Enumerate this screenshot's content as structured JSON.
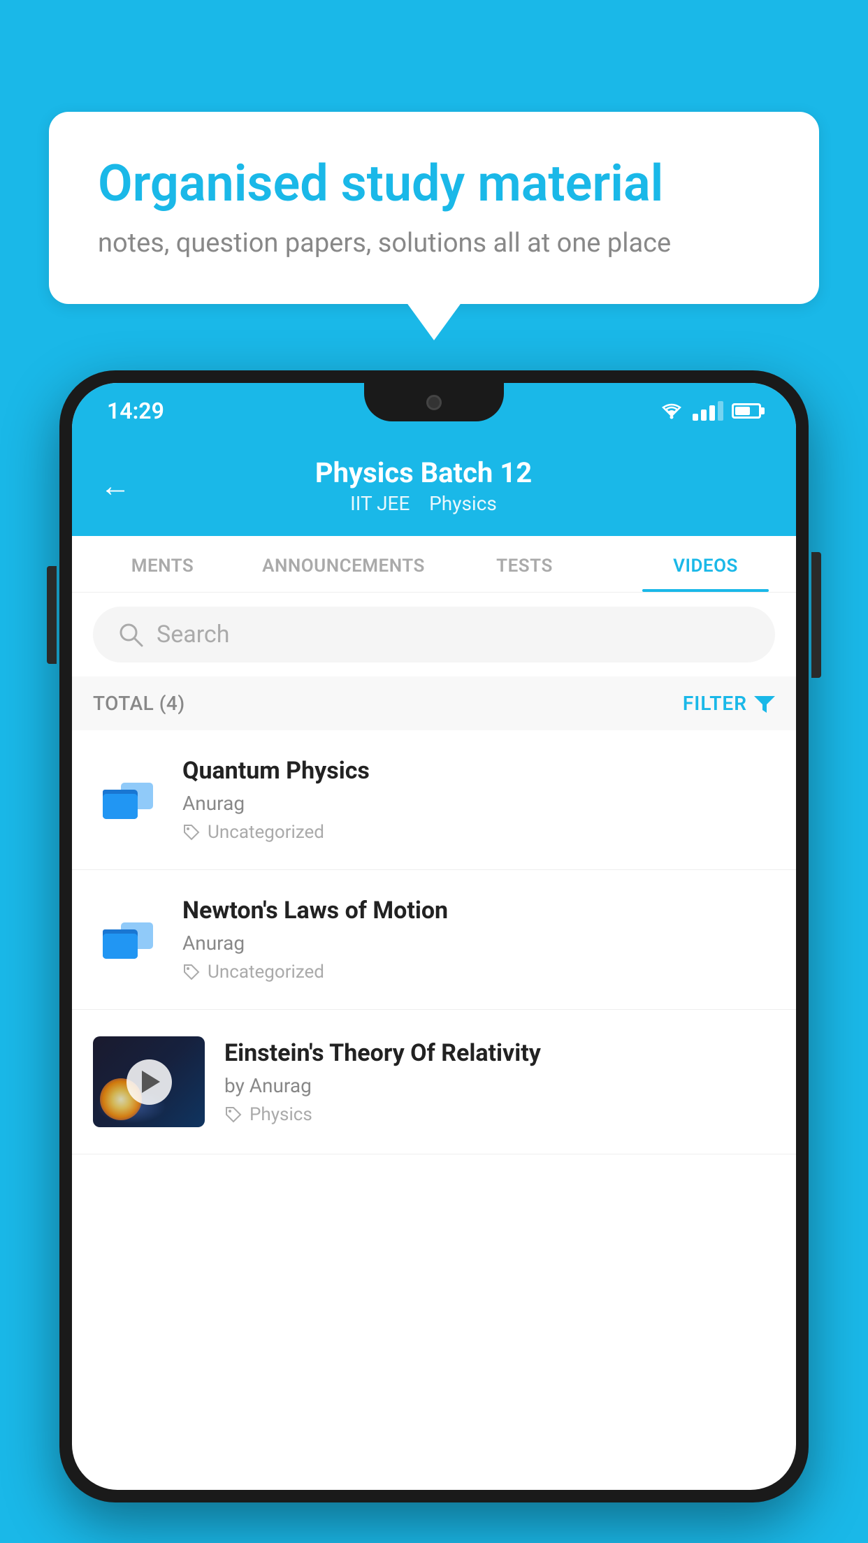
{
  "background_color": "#1ab8e8",
  "speech_bubble": {
    "heading": "Organised study material",
    "subtext": "notes, question papers, solutions all at one place"
  },
  "phone": {
    "status_bar": {
      "time": "14:29",
      "wifi": "▾",
      "signal": true,
      "battery": true
    },
    "header": {
      "back_label": "←",
      "title": "Physics Batch 12",
      "subtitle_part1": "IIT JEE",
      "subtitle_part2": "Physics"
    },
    "tabs": [
      {
        "label": "MENTS",
        "active": false
      },
      {
        "label": "ANNOUNCEMENTS",
        "active": false
      },
      {
        "label": "TESTS",
        "active": false
      },
      {
        "label": "VIDEOS",
        "active": true
      }
    ],
    "search": {
      "placeholder": "Search"
    },
    "filter": {
      "total_label": "TOTAL (4)",
      "filter_label": "FILTER"
    },
    "videos": [
      {
        "title": "Quantum Physics",
        "author": "Anurag",
        "tag": "Uncategorized",
        "has_thumbnail": false
      },
      {
        "title": "Newton's Laws of Motion",
        "author": "Anurag",
        "tag": "Uncategorized",
        "has_thumbnail": false
      },
      {
        "title": "Einstein's Theory Of Relativity",
        "author": "by Anurag",
        "tag": "Physics",
        "has_thumbnail": true
      }
    ]
  }
}
